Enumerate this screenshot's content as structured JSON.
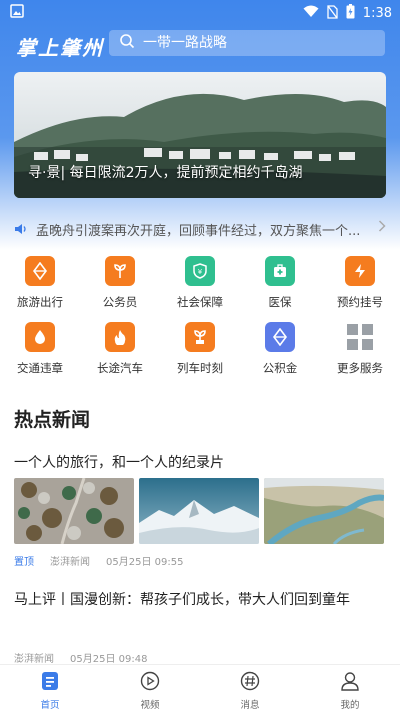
{
  "status_bar": {
    "time": "1:38"
  },
  "app": {
    "logo_text": "掌上肇州"
  },
  "search": {
    "placeholder": "一带一路战略"
  },
  "banner": {
    "caption": "寻·景| 每日限流2万人，提前预定相约千岛湖"
  },
  "notice": {
    "text": "孟晚舟引渡案再次开庭，回顾事件经过，双方聚焦一个..."
  },
  "services": [
    {
      "label": "旅游出行",
      "icon": "travel-icon",
      "color": "#f57c1f"
    },
    {
      "label": "公务员",
      "icon": "civil-servant-icon",
      "color": "#f57c1f"
    },
    {
      "label": "社会保障",
      "icon": "social-security-icon",
      "color": "#2fbf8f"
    },
    {
      "label": "医保",
      "icon": "medical-insurance-icon",
      "color": "#2fbf8f"
    },
    {
      "label": "预约挂号",
      "icon": "appointment-icon",
      "color": "#f57c1f"
    },
    {
      "label": "交通违章",
      "icon": "traffic-violation-icon",
      "color": "#f57c1f"
    },
    {
      "label": "长途汽车",
      "icon": "long-distance-bus-icon",
      "color": "#f57c1f"
    },
    {
      "label": "列车时刻",
      "icon": "train-schedule-icon",
      "color": "#f57c1f"
    },
    {
      "label": "公积金",
      "icon": "housing-fund-icon",
      "color": "#5b7be8"
    },
    {
      "label": "更多服务",
      "icon": "more-services-icon",
      "color": "#9aa0a6"
    }
  ],
  "hot_news": {
    "title": "热点新闻",
    "articles": [
      {
        "title": "一个人的旅行，和一个人的纪录片",
        "tag": "置顶",
        "source": "澎湃新闻",
        "time": "05月25日 09:55"
      },
      {
        "title": "马上评丨国漫创新：帮孩子们成长，带大人们回到童年",
        "source": "澎湃新闻",
        "time": "05月25日 09:48"
      }
    ]
  },
  "tabbar": [
    {
      "label": "首页",
      "icon": "home-icon",
      "active": true
    },
    {
      "label": "视频",
      "icon": "video-icon",
      "active": false
    },
    {
      "label": "消息",
      "icon": "message-icon",
      "active": false
    },
    {
      "label": "我的",
      "icon": "profile-icon",
      "active": false
    }
  ],
  "colors": {
    "primary": "#3a7be8",
    "accent_orange": "#f57c1f",
    "accent_green": "#2fbf8f"
  }
}
